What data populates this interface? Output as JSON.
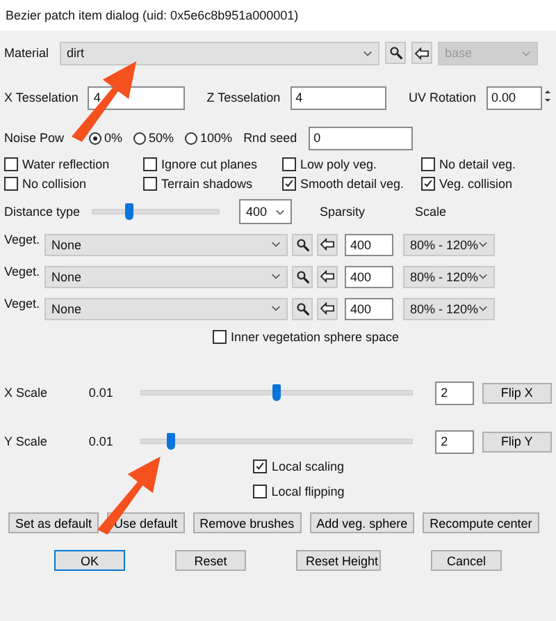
{
  "window": {
    "title": "Bezier patch item dialog (uid: 0x5e6c8b951a000001)"
  },
  "material": {
    "label": "Material",
    "value": "dirt",
    "sub_value": "base",
    "sub_disabled": true
  },
  "tesselation": [
    {
      "label": "X Tesselation",
      "value": "4"
    },
    {
      "label": "Z Tesselation",
      "value": "4"
    }
  ],
  "uv_rotation": {
    "label": "UV Rotation",
    "value": "0.00"
  },
  "noise": {
    "label": "Noise Pow",
    "options": [
      {
        "label": "0%",
        "selected": true
      },
      {
        "label": "50%",
        "selected": false
      },
      {
        "label": "100%",
        "selected": false
      }
    ]
  },
  "rnd_seed": {
    "label": "Rnd seed",
    "value": "0"
  },
  "options": [
    {
      "label": "Water reflection",
      "checked": false
    },
    {
      "label": "Ignore cut planes",
      "checked": false
    },
    {
      "label": "Low poly veg.",
      "checked": false
    },
    {
      "label": "No detail veg.",
      "checked": false
    },
    {
      "label": "No collision",
      "checked": false
    },
    {
      "label": "Terrain shadows",
      "checked": false
    },
    {
      "label": "Smooth detail veg.",
      "checked": true
    },
    {
      "label": "Veg. collision",
      "checked": true
    }
  ],
  "distance": {
    "label": "Distance type",
    "level": 0.29,
    "value": "400"
  },
  "veg_headers": [
    "Sparsity",
    "Scale"
  ],
  "vegetation": [
    {
      "label": "Veget.",
      "value": "None",
      "sparsity": "400",
      "scale": "80% - 120%"
    },
    {
      "label": "Veget.",
      "value": "None",
      "sparsity": "400",
      "scale": "80% - 120%"
    },
    {
      "label": "Veget.",
      "value": "None",
      "sparsity": "400",
      "scale": "80% - 120%"
    }
  ],
  "inner_sphere": {
    "label": "Inner vegetation sphere space",
    "checked": false
  },
  "scales": [
    {
      "label": "X Scale",
      "min": "0.01",
      "level": 0.5,
      "value": "2",
      "button": "Flip X"
    },
    {
      "label": "Y Scale",
      "min": "0.01",
      "level": 0.11,
      "value": "2",
      "button": "Flip Y"
    }
  ],
  "local": [
    {
      "label": "Local scaling",
      "checked": true
    },
    {
      "label": "Local flipping",
      "checked": false
    }
  ],
  "actions": [
    "Set as default",
    "Use default",
    "Remove brushes",
    "Add veg. sphere",
    "Recompute center"
  ],
  "footer": [
    {
      "label": "OK",
      "default": true
    },
    {
      "label": "Reset",
      "default": false
    },
    {
      "label": "Reset Height",
      "default": false
    },
    {
      "label": "Cancel",
      "default": false
    }
  ]
}
